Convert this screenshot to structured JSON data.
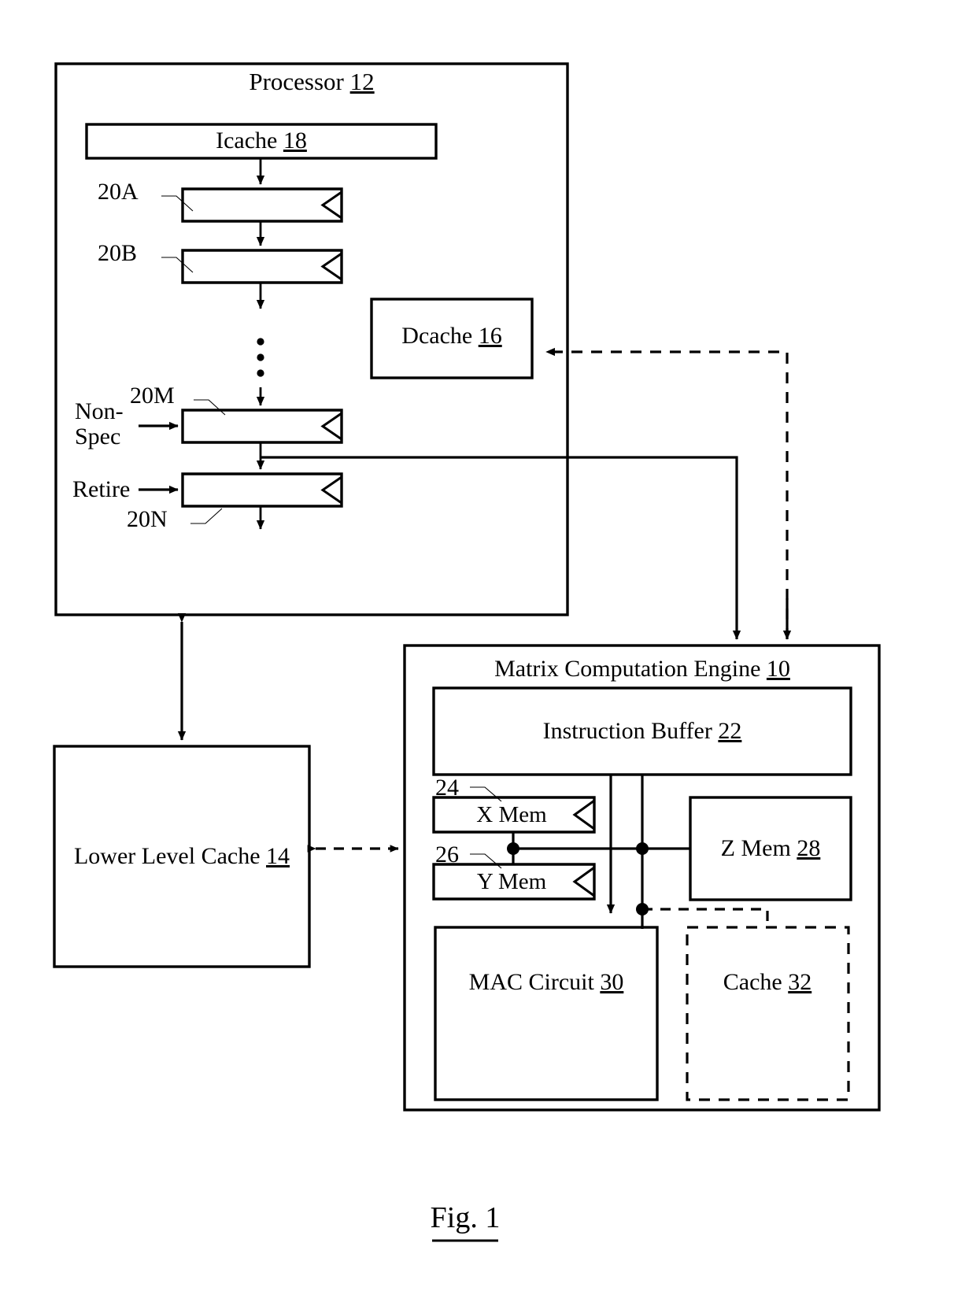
{
  "figure": {
    "caption": "Fig. 1",
    "caption_number": "1"
  },
  "processor": {
    "title_text": "Processor",
    "title_ref": "12",
    "icache": {
      "text": "Icache",
      "ref": "18"
    },
    "dcache": {
      "text": "Dcache",
      "ref": "16"
    },
    "pipeline_stages": [
      {
        "ref": "20A"
      },
      {
        "ref": "20B"
      },
      {
        "ref": "20M"
      },
      {
        "ref": "20N"
      }
    ],
    "side_labels": [
      {
        "line1": "Non-",
        "line2": "Spec"
      },
      {
        "line1": "Retire",
        "line2": ""
      }
    ],
    "ellipsis_dots": 3
  },
  "lower_level_cache": {
    "text": "Lower Level Cache",
    "ref": "14"
  },
  "matrix_engine": {
    "title_text": "Matrix Computation Engine",
    "title_ref": "10",
    "instruction_buffer": {
      "text": "Instruction Buffer",
      "ref": "22"
    },
    "x_mem": {
      "text": "X Mem",
      "ref": "24"
    },
    "y_mem": {
      "text": "Y Mem",
      "ref": "26"
    },
    "z_mem": {
      "text": "Z Mem",
      "ref": "28"
    },
    "mac_circuit": {
      "text": "MAC Circuit",
      "ref": "30"
    },
    "cache": {
      "text": "Cache",
      "ref": "32",
      "border": "dashed"
    }
  },
  "colors": {
    "stroke": "#000000",
    "background": "#ffffff"
  }
}
